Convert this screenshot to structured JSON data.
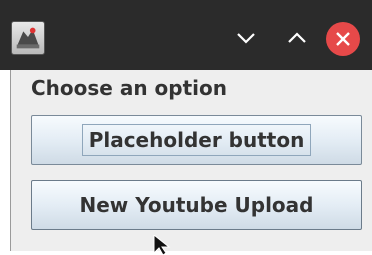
{
  "window": {
    "icons": {
      "app": "app-icon",
      "minimize": "chevron-down-icon",
      "maximize": "chevron-up-icon",
      "close": "close-icon",
      "cursor": "mouse-pointer-icon"
    },
    "colors": {
      "titlebar": "#2b2b2b",
      "close": "#e64949",
      "dialog_bg": "#eeeeee",
      "text": "#333333"
    }
  },
  "dialog": {
    "prompt": "Choose an option",
    "buttons": [
      {
        "label": "Placeholder button",
        "focused": true
      },
      {
        "label": "New Youtube Upload",
        "focused": false
      }
    ]
  }
}
